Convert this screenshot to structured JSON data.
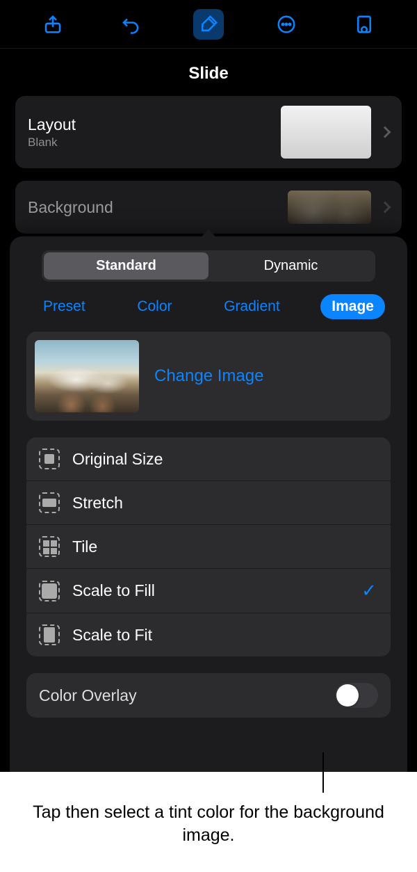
{
  "toolbar": {
    "share_icon": "share",
    "undo_icon": "undo",
    "format_icon": "format-brush",
    "more_icon": "more",
    "document_icon": "document-settings"
  },
  "panel": {
    "title": "Slide"
  },
  "layout": {
    "label": "Layout",
    "name": "Blank"
  },
  "background": {
    "label": "Background"
  },
  "popover": {
    "segment": {
      "standard": "Standard",
      "dynamic": "Dynamic",
      "selected": "Standard"
    },
    "tabs": {
      "preset": "Preset",
      "color": "Color",
      "gradient": "Gradient",
      "image": "Image",
      "selected": "Image"
    },
    "change_image": "Change Image",
    "scale_options": [
      {
        "id": "original",
        "label": "Original Size",
        "selected": false
      },
      {
        "id": "stretch",
        "label": "Stretch",
        "selected": false
      },
      {
        "id": "tile",
        "label": "Tile",
        "selected": false
      },
      {
        "id": "scalefill",
        "label": "Scale to Fill",
        "selected": true
      },
      {
        "id": "scalefit",
        "label": "Scale to Fit",
        "selected": false
      }
    ],
    "color_overlay": {
      "label": "Color Overlay",
      "on": false
    }
  },
  "callout": {
    "text": "Tap then select a tint color for the background image."
  }
}
